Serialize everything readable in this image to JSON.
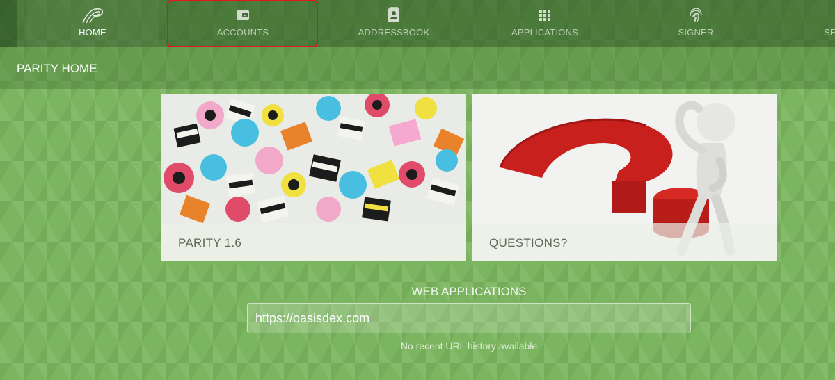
{
  "nav": {
    "tabs": [
      {
        "label": "HOME",
        "icon": "parity-logo-icon",
        "active": true
      },
      {
        "label": "ACCOUNTS",
        "icon": "wallet-icon",
        "active": false,
        "highlighted": true
      },
      {
        "label": "ADDRESSBOOK",
        "icon": "contact-card-icon",
        "active": false
      },
      {
        "label": "APPLICATIONS",
        "icon": "apps-grid-icon",
        "active": false
      },
      {
        "label": "SIGNER",
        "icon": "fingerprint-icon",
        "active": false
      },
      {
        "label": "SE",
        "icon": "",
        "active": false
      }
    ],
    "highlight_color": "#e0171b"
  },
  "page": {
    "title": "PARITY HOME"
  },
  "cards": [
    {
      "caption": "PARITY 1.6",
      "image": "licorice-allsorts-candy"
    },
    {
      "caption": "QUESTIONS?",
      "image": "figure-on-question-mark"
    }
  ],
  "web_apps": {
    "title": "WEB APPLICATIONS",
    "url_value": "https://oasisdex.com",
    "history_note": "No recent URL history available"
  },
  "colors": {
    "background": "#7bb55f",
    "nav_bar": "#2d5523"
  }
}
